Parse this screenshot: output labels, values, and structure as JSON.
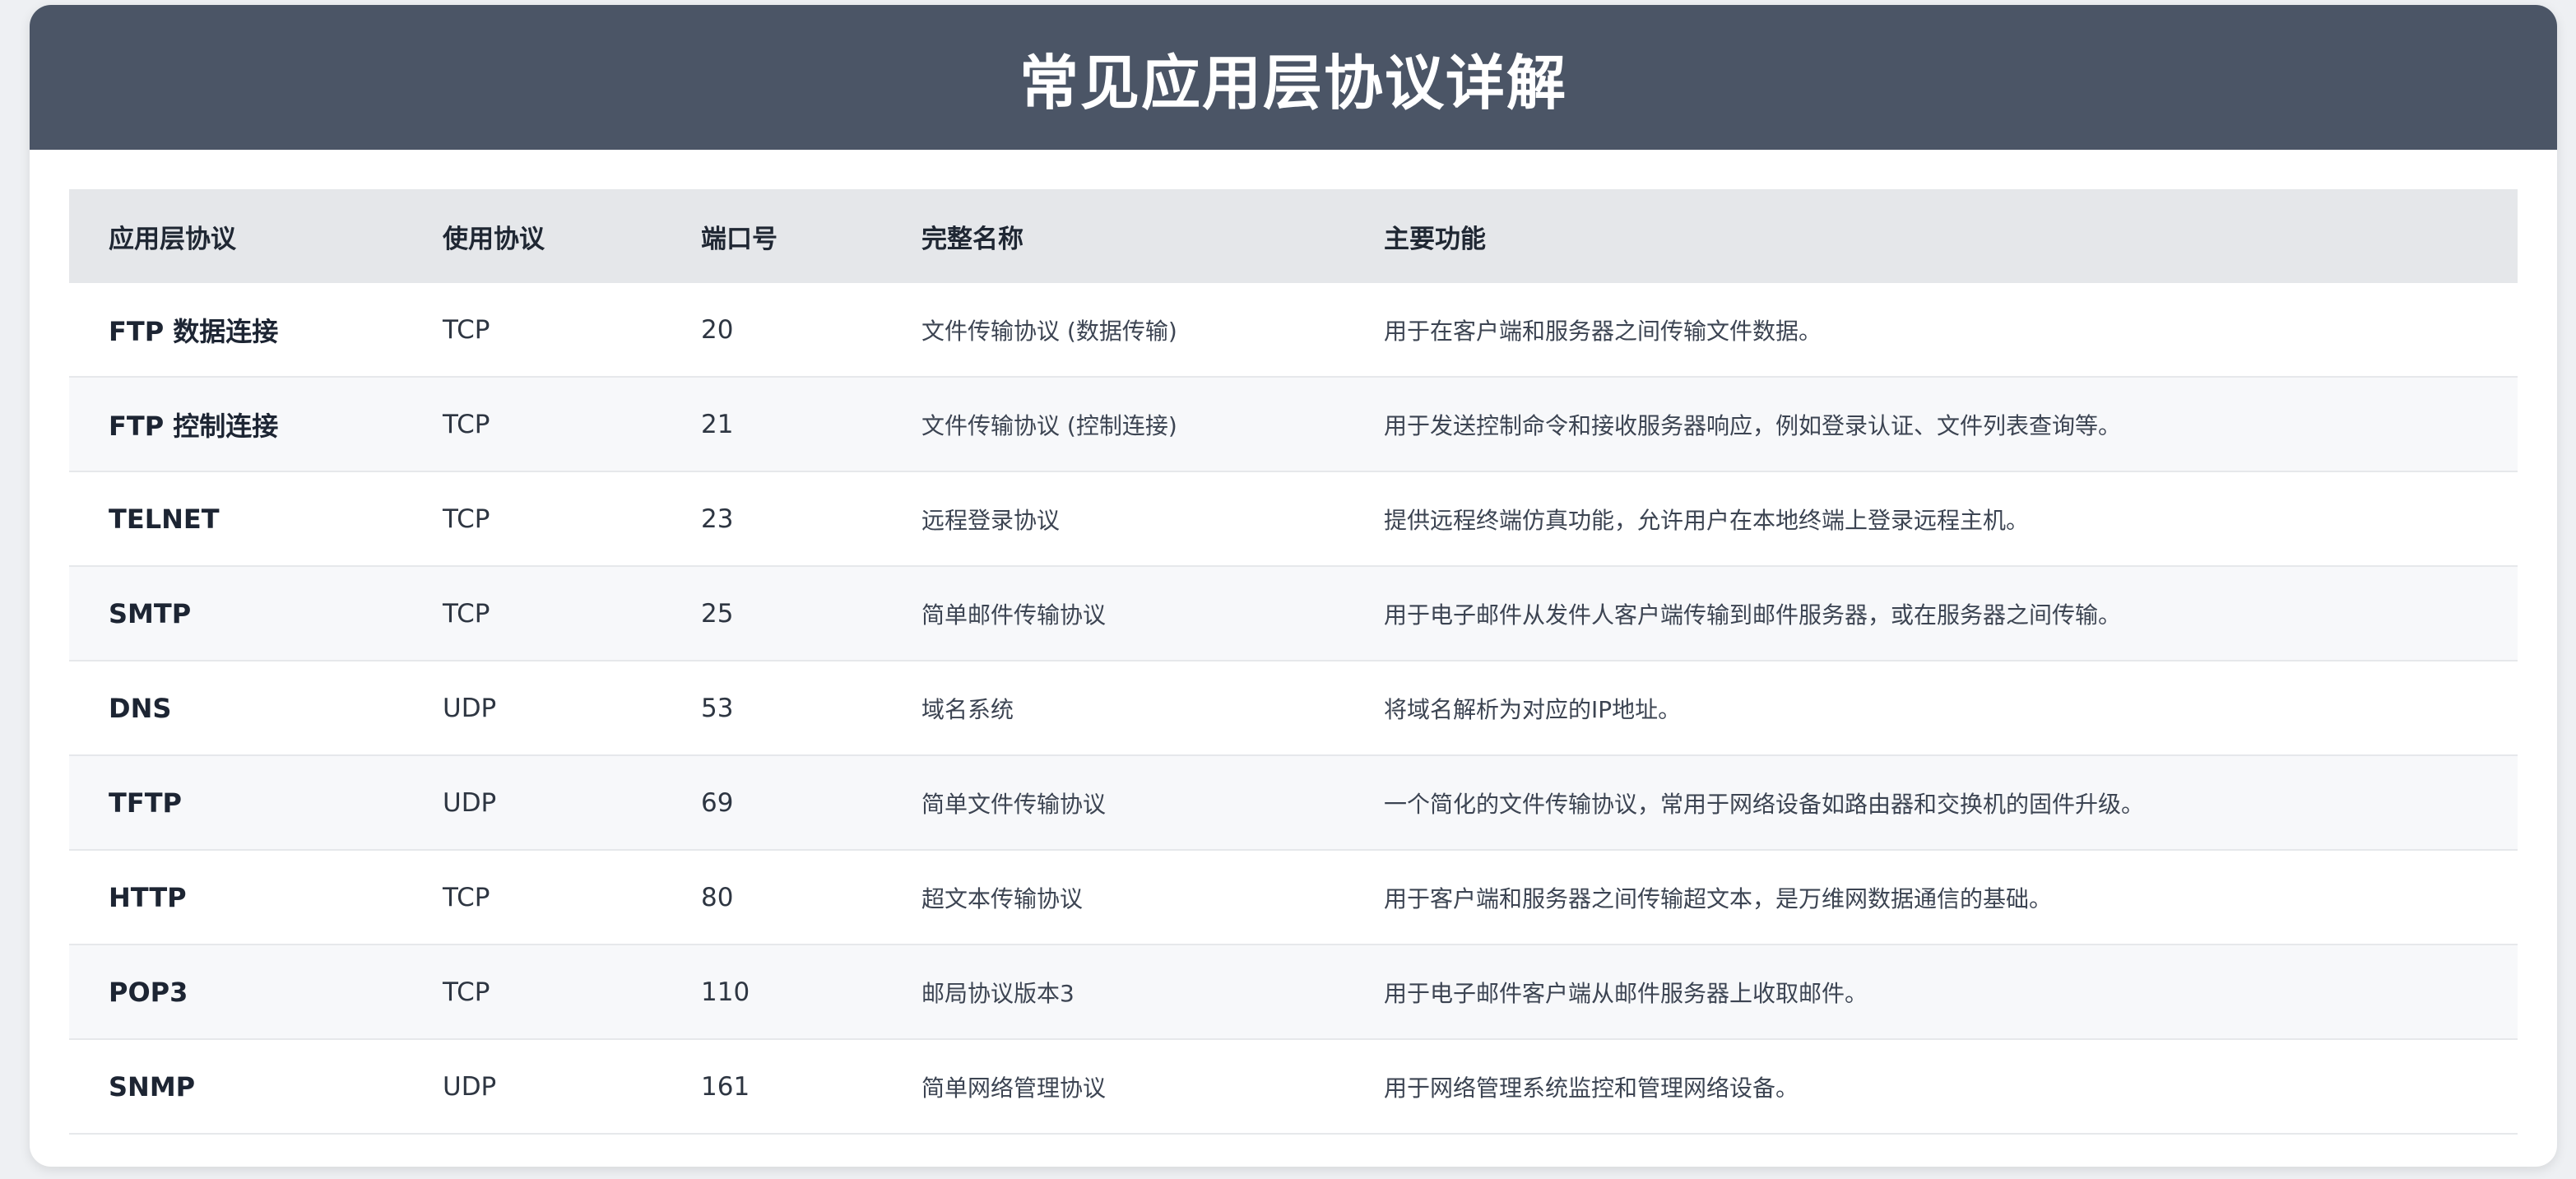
{
  "title": "常见应用层协议详解",
  "columns": [
    "应用层协议",
    "使用协议",
    "端口号",
    "完整名称",
    "主要功能"
  ],
  "rows": [
    {
      "name": "FTP 数据连接",
      "transport": "TCP",
      "port": "20",
      "full_name": "文件传输协议 (数据传输)",
      "function": "用于在客户端和服务器之间传输文件数据。"
    },
    {
      "name": "FTP 控制连接",
      "transport": "TCP",
      "port": "21",
      "full_name": "文件传输协议 (控制连接)",
      "function": "用于发送控制命令和接收服务器响应，例如登录认证、文件列表查询等。"
    },
    {
      "name": "TELNET",
      "transport": "TCP",
      "port": "23",
      "full_name": "远程登录协议",
      "function": "提供远程终端仿真功能，允许用户在本地终端上登录远程主机。"
    },
    {
      "name": "SMTP",
      "transport": "TCP",
      "port": "25",
      "full_name": "简单邮件传输协议",
      "function": "用于电子邮件从发件人客户端传输到邮件服务器，或在服务器之间传输。"
    },
    {
      "name": "DNS",
      "transport": "UDP",
      "port": "53",
      "full_name": "域名系统",
      "function": "将域名解析为对应的IP地址。"
    },
    {
      "name": "TFTP",
      "transport": "UDP",
      "port": "69",
      "full_name": "简单文件传输协议",
      "function": "一个简化的文件传输协议，常用于网络设备如路由器和交换机的固件升级。"
    },
    {
      "name": "HTTP",
      "transport": "TCP",
      "port": "80",
      "full_name": "超文本传输协议",
      "function": "用于客户端和服务器之间传输超文本，是万维网数据通信的基础。"
    },
    {
      "name": "POP3",
      "transport": "TCP",
      "port": "110",
      "full_name": "邮局协议版本3",
      "function": "用于电子邮件客户端从邮件服务器上收取邮件。"
    },
    {
      "name": "SNMP",
      "transport": "UDP",
      "port": "161",
      "full_name": "简单网络管理协议",
      "function": "用于网络管理系统监控和管理网络设备。"
    }
  ]
}
